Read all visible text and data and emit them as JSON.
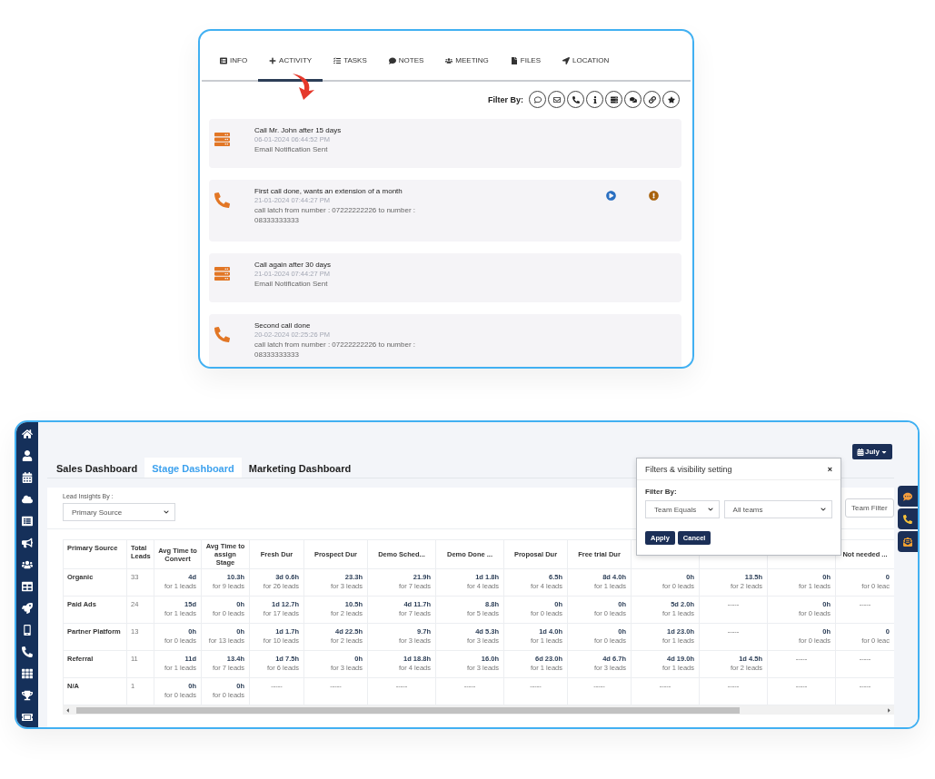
{
  "activity_panel": {
    "tabs": [
      {
        "label": "INFO",
        "selected": false
      },
      {
        "label": "ACTIVITY",
        "selected": true
      },
      {
        "label": "TASKS",
        "selected": false
      },
      {
        "label": "NOTES",
        "selected": false
      },
      {
        "label": "MEETING",
        "selected": false
      },
      {
        "label": "FILES",
        "selected": false
      },
      {
        "label": "LOCATION",
        "selected": false
      }
    ],
    "filter_label": "Filter By:",
    "activities": [
      {
        "kind": "task",
        "title": "Call Mr. John after 15 days",
        "date": "06-01-2024 06:44:52 PM",
        "description": "Email Notification Sent",
        "recording": false,
        "flagged": false
      },
      {
        "kind": "call",
        "title": "First call done, wants an extension of a month",
        "date": "21-01-2024 07:44:27 PM",
        "description": "call latch from number : 07222222226 to number : 08333333333",
        "recording": true,
        "flagged": true
      },
      {
        "kind": "task",
        "title": "Call again after 30 days",
        "date": "21-01-2024 07:44:27 PM",
        "description": "Email Notification Sent",
        "recording": false,
        "flagged": false
      },
      {
        "kind": "call",
        "title": "Second call done",
        "date": "20-02-2024 02:25:26 PM",
        "description": "call latch from number : 07222222226 to number : 08333333333",
        "recording": false,
        "flagged": false
      }
    ]
  },
  "dashboard": {
    "tabs": [
      {
        "label": "Sales Dashboard",
        "selected": false
      },
      {
        "label": "Stage Dashboard",
        "selected": true
      },
      {
        "label": "Marketing Dashboard",
        "selected": false
      }
    ],
    "month_button": "July",
    "insights_label": "Lead Insights By :",
    "insights_select": "Primary Source",
    "team_filter_button": "Team Filter",
    "filter_popup": {
      "title": "Filters & visibility setting",
      "close": "×",
      "filter_label": "Filter By:",
      "condition": "Team Equals",
      "team": "All teams",
      "apply": "Apply",
      "cancel": "Cancel"
    },
    "table": {
      "columns": [
        {
          "label": "Primary Source"
        },
        {
          "label": "Total Leads"
        },
        {
          "label": "Avg Time to Convert"
        },
        {
          "label": "Avg Time to assign Stage"
        },
        {
          "label": "Fresh Dur"
        },
        {
          "label": "Prospect Dur"
        },
        {
          "label": "Demo Sched..."
        },
        {
          "label": "Demo Done ..."
        },
        {
          "label": "Proposal Dur"
        },
        {
          "label": "Free trial Dur"
        },
        {
          "kind": "covered"
        },
        {
          "kind": "covered"
        },
        {
          "kind": "covered"
        },
        {
          "label": "Not needed ..."
        }
      ],
      "rows": [
        {
          "cells": [
            {
              "value": "Organic"
            },
            {
              "value": "33"
            },
            {
              "value": "4d",
              "count": "for 1 leads"
            },
            {
              "value": "10.3h",
              "count": "for 9 leads"
            },
            {
              "value": "3d 0.6h",
              "count": "for 26 leads"
            },
            {
              "value": "23.3h",
              "count": "for 3 leads"
            },
            {
              "value": "21.9h",
              "count": "for 7 leads"
            },
            {
              "value": "1d 1.8h",
              "count": "for 4 leads"
            },
            {
              "value": "6.5h",
              "count": "for 4 leads"
            },
            {
              "value": "8d 4.0h",
              "count": "for 1 leads"
            },
            {
              "value": "0h",
              "count": "for 0 leads"
            },
            {
              "value": "13.5h",
              "count": "for 2 leads"
            },
            {
              "value": "0h",
              "count": "for 1 leads"
            },
            {
              "value": "0",
              "count": "for 0 leac"
            }
          ]
        },
        {
          "cells": [
            {
              "value": "Paid Ads"
            },
            {
              "value": "24"
            },
            {
              "value": "15d",
              "count": "for 1 leads"
            },
            {
              "value": "0h",
              "count": "for 0 leads"
            },
            {
              "value": "1d 12.7h",
              "count": "for 17 leads"
            },
            {
              "value": "10.5h",
              "count": "for 2 leads"
            },
            {
              "value": "4d 11.7h",
              "count": "for 7 leads"
            },
            {
              "value": "8.8h",
              "count": "for 5 leads"
            },
            {
              "value": "0h",
              "count": "for 0 leads"
            },
            {
              "value": "0h",
              "count": "for 0 leads"
            },
            {
              "value": "5d 2.0h",
              "count": "for 1 leads"
            },
            {
              "value": "-----"
            },
            {
              "value": "0h",
              "count": "for 0 leads"
            },
            {
              "value": "-----"
            }
          ]
        },
        {
          "cells": [
            {
              "value": "Partner Platform"
            },
            {
              "value": "13"
            },
            {
              "value": "0h",
              "count": "for 0 leads"
            },
            {
              "value": "0h",
              "count": "for 13 leads"
            },
            {
              "value": "1d 1.7h",
              "count": "for 10 leads"
            },
            {
              "value": "4d 22.5h",
              "count": "for 2 leads"
            },
            {
              "value": "9.7h",
              "count": "for 3 leads"
            },
            {
              "value": "4d 5.3h",
              "count": "for 3 leads"
            },
            {
              "value": "1d 4.0h",
              "count": "for 1 leads"
            },
            {
              "value": "0h",
              "count": "for 0 leads"
            },
            {
              "value": "1d 23.0h",
              "count": "for 1 leads"
            },
            {
              "value": "-----"
            },
            {
              "value": "0h",
              "count": "for 0 leads"
            },
            {
              "value": "0",
              "count": "for 0 leac"
            }
          ]
        },
        {
          "cells": [
            {
              "value": "Referral"
            },
            {
              "value": "11"
            },
            {
              "value": "11d",
              "count": "for 1 leads"
            },
            {
              "value": "13.4h",
              "count": "for 7 leads"
            },
            {
              "value": "1d 7.5h",
              "count": "for 6 leads"
            },
            {
              "value": "0h",
              "count": "for 3 leads"
            },
            {
              "value": "1d 18.8h",
              "count": "for 4 leads"
            },
            {
              "value": "16.0h",
              "count": "for 3 leads"
            },
            {
              "value": "6d 23.0h",
              "count": "for 1 leads"
            },
            {
              "value": "4d 6.7h",
              "count": "for 3 leads"
            },
            {
              "value": "4d 19.0h",
              "count": "for 1 leads"
            },
            {
              "value": "1d 4.5h",
              "count": "for 2 leads"
            },
            {
              "value": "-----"
            },
            {
              "value": "-----"
            }
          ]
        },
        {
          "cells": [
            {
              "value": "N/A"
            },
            {
              "value": "1"
            },
            {
              "value": "0h",
              "count": "for 0 leads"
            },
            {
              "value": "0h",
              "count": "for 0 leads"
            },
            {
              "value": "-----"
            },
            {
              "value": "-----"
            },
            {
              "value": "-----"
            },
            {
              "value": "-----"
            },
            {
              "value": "-----"
            },
            {
              "value": "-----"
            },
            {
              "value": "-----"
            },
            {
              "value": "-----"
            },
            {
              "value": "-----"
            },
            {
              "value": "-----"
            }
          ]
        }
      ]
    }
  }
}
